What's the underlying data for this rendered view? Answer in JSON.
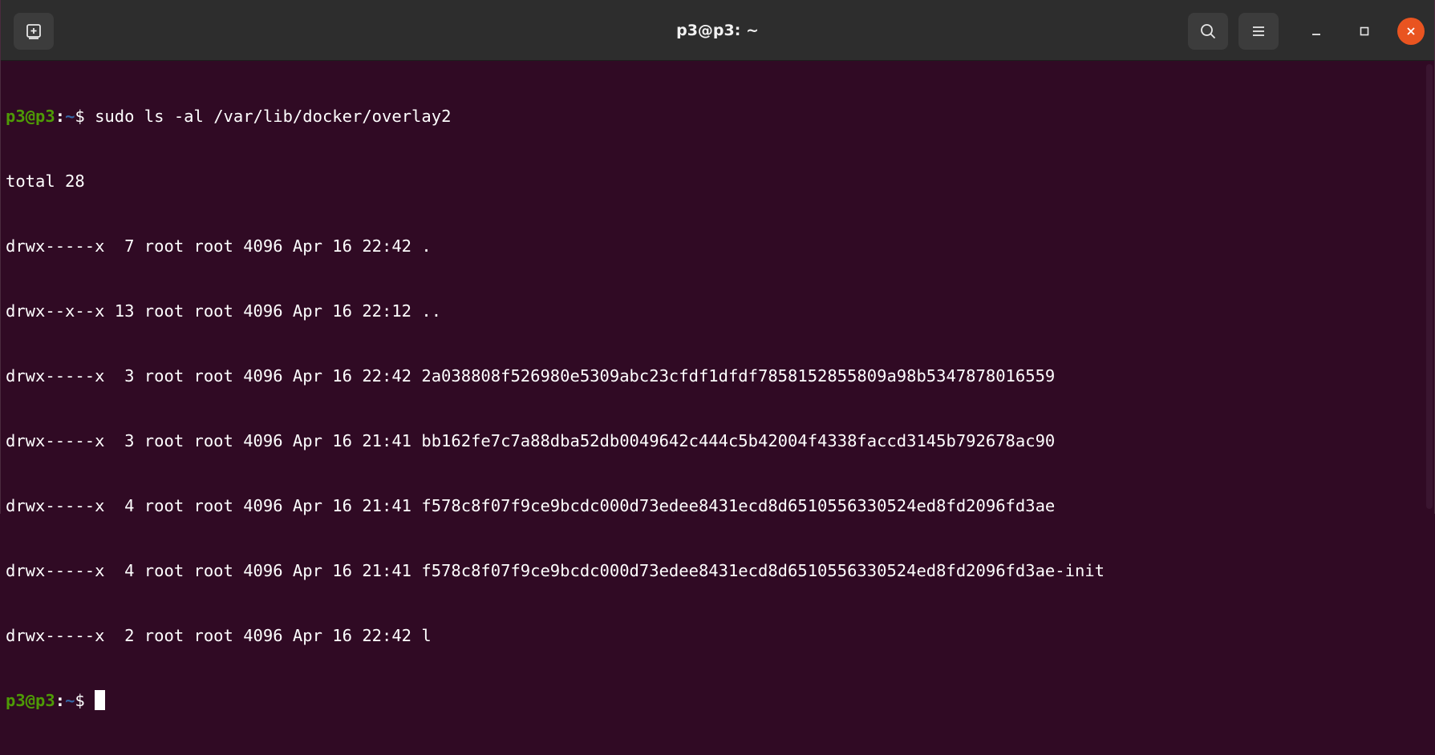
{
  "window": {
    "title": "p3@p3: ~"
  },
  "icons": {
    "new_tab": "new-tab-icon",
    "search": "search-icon",
    "menu": "hamburger-menu-icon",
    "minimize": "minimize-icon",
    "maximize": "maximize-icon",
    "close": "close-icon"
  },
  "colors": {
    "terminal_bg": "#300a24",
    "titlebar_bg": "#2d2d2d",
    "prompt_user": "#4e9a06",
    "prompt_path": "#3465a4",
    "close_button": "#e95420"
  },
  "prompt": {
    "user_host": "p3@p3",
    "separator": ":",
    "path": "~",
    "symbol": "$ "
  },
  "command": "sudo ls -al /var/lib/docker/overlay2",
  "output": [
    "total 28",
    "drwx-----x  7 root root 4096 Apr 16 22:42 .",
    "drwx--x--x 13 root root 4096 Apr 16 22:12 ..",
    "drwx-----x  3 root root 4096 Apr 16 22:42 2a038808f526980e5309abc23cfdf1dfdf7858152855809a98b5347878016559",
    "drwx-----x  3 root root 4096 Apr 16 21:41 bb162fe7c7a88dba52db0049642c444c5b42004f4338faccd3145b792678ac90",
    "drwx-----x  4 root root 4096 Apr 16 21:41 f578c8f07f9ce9bcdc000d73edee8431ecd8d6510556330524ed8fd2096fd3ae",
    "drwx-----x  4 root root 4096 Apr 16 21:41 f578c8f07f9ce9bcdc000d73edee8431ecd8d6510556330524ed8fd2096fd3ae-init",
    "drwx-----x  2 root root 4096 Apr 16 22:42 l"
  ]
}
